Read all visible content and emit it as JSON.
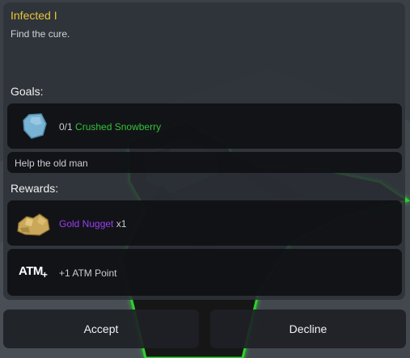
{
  "quest": {
    "title": "Infected I",
    "description": "Find the cure."
  },
  "goals": {
    "label": "Goals:",
    "items": [
      {
        "progress": "0/1",
        "name": "Crushed Snowberry",
        "icon": "snowberry-icon"
      },
      {
        "text": "Help the old man"
      }
    ]
  },
  "rewards": {
    "label": "Rewards:",
    "items": [
      {
        "name": "Gold Nugget",
        "quantity": "x1",
        "icon": "gold-nugget-icon"
      },
      {
        "icon_text": "ATM",
        "icon_plus": "+",
        "text": "+1 ATM Point"
      }
    ]
  },
  "buttons": {
    "accept": "Accept",
    "decline": "Decline"
  },
  "colors": {
    "title": "#e7c53c",
    "item_green": "#33c238",
    "item_purple": "#9a3ff0",
    "glow": "#2fd12f"
  }
}
